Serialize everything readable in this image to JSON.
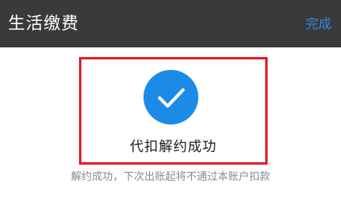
{
  "header": {
    "title": "生活缴费",
    "done_label": "完成"
  },
  "result": {
    "icon": "check-circle-icon",
    "message": "代扣解约成功",
    "note": "解约成功，下次出账起将不通过本账户扣款"
  },
  "colors": {
    "topbar_bg": "#3a3a3a",
    "accent_blue": "#2c8ee0",
    "icon_blue": "#1b8be6",
    "highlight_red": "#e0202a"
  }
}
